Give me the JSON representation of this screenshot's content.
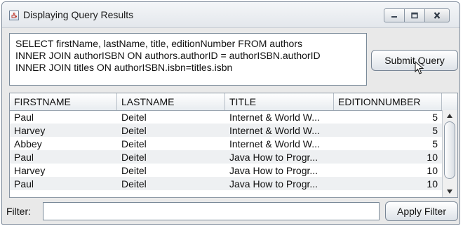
{
  "window": {
    "title": "Displaying Query Results"
  },
  "icons": {
    "app": "java-cup-icon",
    "minimize": "minimize-icon",
    "maximize": "maximize-icon",
    "close": "close-icon",
    "cursor": "mouse-pointer-icon"
  },
  "query": {
    "lines": [
      "SELECT firstName, lastName, title, editionNumber FROM authors",
      "INNER JOIN authorISBN ON authors.authorID = authorISBN.authorID",
      "INNER JOIN titles ON authorISBN.isbn=titles.isbn"
    ]
  },
  "buttons": {
    "submit": "Submit Query",
    "apply_filter": "Apply Filter"
  },
  "table": {
    "columns": [
      "FIRSTNAME",
      "LASTNAME",
      "TITLE",
      "EDITIONNUMBER"
    ],
    "rows": [
      [
        "Paul",
        "Deitel",
        "Internet & World W...",
        "5"
      ],
      [
        "Harvey",
        "Deitel",
        "Internet & World W...",
        "5"
      ],
      [
        "Abbey",
        "Deitel",
        "Internet & World W...",
        "5"
      ],
      [
        "Paul",
        "Deitel",
        "Java How to Progr...",
        "10"
      ],
      [
        "Harvey",
        "Deitel",
        "Java How to Progr...",
        "10"
      ],
      [
        "Paul",
        "Deitel",
        "Java How to Progr...",
        "10"
      ]
    ]
  },
  "filter": {
    "label": "Filter:",
    "value": "",
    "placeholder": ""
  },
  "colors": {
    "border": "#7a8a99",
    "row_alt": "#eef0f2",
    "window_bg": "#e9e9e9"
  }
}
